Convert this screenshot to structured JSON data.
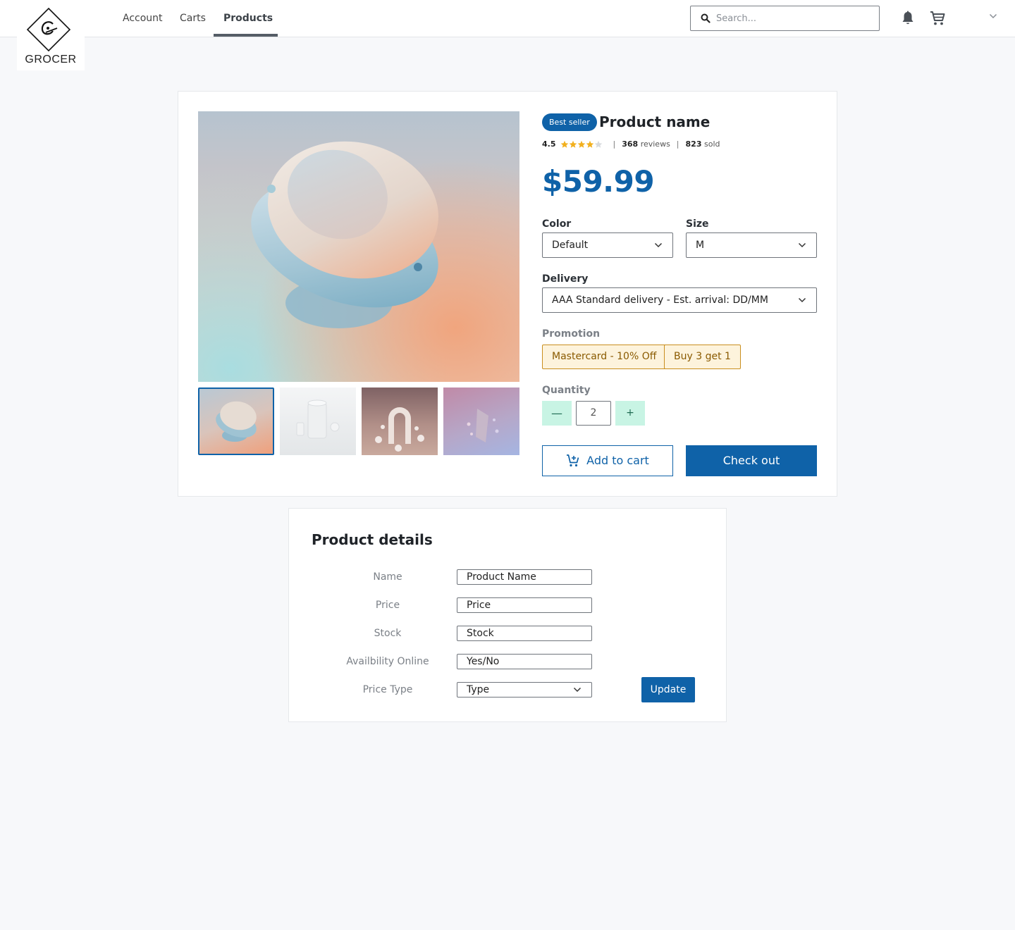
{
  "brand": {
    "name": "GROCER"
  },
  "nav": {
    "tabs": [
      {
        "label": "Account"
      },
      {
        "label": "Carts"
      },
      {
        "label": "Products",
        "active": true
      }
    ]
  },
  "search": {
    "placeholder": "Search..."
  },
  "icons": {
    "search": "search-icon",
    "notifications": "bell-icon",
    "cart": "cart-icon",
    "user_menu": "chevron-down-icon"
  },
  "colors": {
    "accent": "#0f62a8",
    "promo_border": "#c98e1e",
    "promo_text": "#8a5a00",
    "quantity_button": "#c8f4e4",
    "star": "#f2b01e"
  },
  "product": {
    "badge": "Best seller",
    "name": "Product name",
    "rating": "4.5",
    "rating_stars": 4.5,
    "reviews_count": "368",
    "reviews_label": "reviews",
    "sold_count": "823",
    "sold_label": "sold",
    "price": "$59.99",
    "thumbnails_count": 4,
    "selected_thumbnail": 1
  },
  "options": {
    "color": {
      "label": "Color",
      "value": "Default"
    },
    "size": {
      "label": "Size",
      "value": "M"
    },
    "delivery": {
      "label": "Delivery",
      "value": "AAA Standard delivery - Est. arrival: DD/MM"
    }
  },
  "promotion": {
    "label": "Promotion",
    "items": [
      "Mastercard - 10% Off",
      "Buy 3 get 1"
    ]
  },
  "quantity": {
    "label": "Quantity",
    "value": "2",
    "decrement": "—",
    "increment": "+"
  },
  "actions": {
    "add_to_cart": "Add to cart",
    "checkout": "Check out"
  },
  "details": {
    "title": "Product details",
    "fields": [
      {
        "label": "Name",
        "value": "Product Name"
      },
      {
        "label": "Price",
        "value": "Price"
      },
      {
        "label": "Stock",
        "value": "Stock"
      },
      {
        "label": "Availbility Online",
        "value": "Yes/No"
      },
      {
        "label": "Price Type",
        "value": "Type"
      }
    ],
    "update": "Update"
  }
}
